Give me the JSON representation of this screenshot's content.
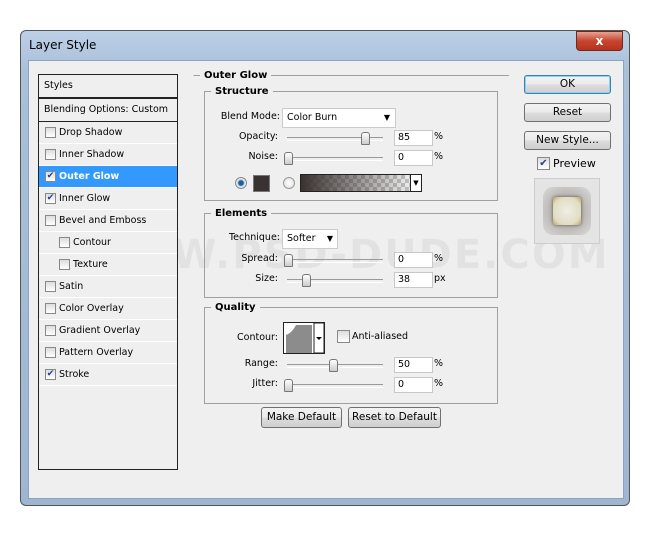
{
  "window": {
    "title": "Layer Style",
    "close": "x"
  },
  "sidebar": {
    "header": "Styles",
    "blending": "Blending Options: Custom",
    "items": [
      {
        "label": "Drop Shadow",
        "checked": false,
        "indent": false,
        "selected": false
      },
      {
        "label": "Inner Shadow",
        "checked": false,
        "indent": false,
        "selected": false
      },
      {
        "label": "Outer Glow",
        "checked": true,
        "indent": false,
        "selected": true
      },
      {
        "label": "Inner Glow",
        "checked": true,
        "indent": false,
        "selected": false
      },
      {
        "label": "Bevel and Emboss",
        "checked": false,
        "indent": false,
        "selected": false
      },
      {
        "label": "Contour",
        "checked": false,
        "indent": true,
        "selected": false
      },
      {
        "label": "Texture",
        "checked": false,
        "indent": true,
        "selected": false
      },
      {
        "label": "Satin",
        "checked": false,
        "indent": false,
        "selected": false
      },
      {
        "label": "Color Overlay",
        "checked": false,
        "indent": false,
        "selected": false
      },
      {
        "label": "Gradient Overlay",
        "checked": false,
        "indent": false,
        "selected": false
      },
      {
        "label": "Pattern Overlay",
        "checked": false,
        "indent": false,
        "selected": false
      },
      {
        "label": "Stroke",
        "checked": true,
        "indent": false,
        "selected": false
      }
    ]
  },
  "panel": {
    "title": "Outer Glow",
    "structure": {
      "title": "Structure",
      "blend_label": "Blend Mode:",
      "blend_value": "Color Burn",
      "opacity": {
        "label": "Opacity:",
        "value": "85",
        "unit": "%",
        "fraction": 0.85
      },
      "noise": {
        "label": "Noise:",
        "value": "0",
        "unit": "%",
        "fraction": 0
      },
      "glow_color": "#3a3230"
    },
    "elements": {
      "title": "Elements",
      "technique_label": "Technique:",
      "technique_value": "Softer",
      "spread": {
        "label": "Spread:",
        "value": "0",
        "unit": "%",
        "fraction": 0
      },
      "size": {
        "label": "Size:",
        "value": "38",
        "unit": "px",
        "fraction": 0.2
      }
    },
    "quality": {
      "title": "Quality",
      "contour_label": "Contour:",
      "antialiased": "Anti-aliased",
      "range": {
        "label": "Range:",
        "value": "50",
        "unit": "%",
        "fraction": 0.5
      },
      "jitter": {
        "label": "Jitter:",
        "value": "0",
        "unit": "%",
        "fraction": 0
      }
    },
    "make_default": "Make Default",
    "reset_default": "Reset to Default"
  },
  "actions": {
    "ok": "OK",
    "reset": "Reset",
    "new_style": "New Style...",
    "preview": "Preview"
  },
  "watermark": "WWW.PSD-DUDE.COM"
}
